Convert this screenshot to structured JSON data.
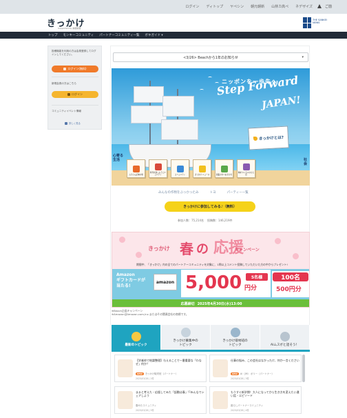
{
  "topbar": {
    "links": [
      "ログイン",
      "ディトップ",
      "ヤペシン",
      "朝元朝新",
      "山林カ高ペ",
      "ネデザイズ"
    ],
    "login": "ご前"
  },
  "header": {
    "logo": "きっかけ",
    "logo_sub": "Supported by 産経新聞",
    "news_name": "THE SANKEI NEWS"
  },
  "nav": {
    "items": [
      "トップ",
      "モンキーコミュニティ",
      "パートナーコミュニティ一覧",
      "ボキガイド ▾"
    ]
  },
  "sidebar": {
    "login_desc": "投稿機能を利用の方は会員登録してログインしてください。",
    "login_button": "ログイン(無料)",
    "register_desc": "新規会員の方はこちら",
    "register_button": "ログイン",
    "community_label": "コミュニティイベント情報",
    "small_link": "詳しく見る"
  },
  "main": {
    "dropdown_value": "<3/26> Beachから1年のお知らせ",
    "hero": {
      "jp_title": "ニッポンを一歩先へ",
      "en_title_1": "Step Forward",
      "en_title_2": "JAPAN!",
      "what_label": "きっかけとは?",
      "left_label": "心寄る生活",
      "right_label": "社会",
      "cards": [
        {
          "label": "ムラさん記事の場",
          "color": "#e86a2a"
        },
        {
          "label": "時代を楽しもうコミュニティ",
          "color": "#d84a3a"
        },
        {
          "label": "コミュニティ",
          "color": "#3a8ad8"
        },
        {
          "label": "きっかけ ニュース",
          "color": "#f2c01e"
        },
        {
          "label": "創業の方へおまかせ",
          "color": "#5aa84a"
        },
        {
          "label": "物をつくる人のひろば",
          "color": "#8a5ab0"
        }
      ]
    },
    "links": [
      "みんなの作物をぶっかったみ",
      "トヨ",
      "パーティー一覧"
    ],
    "cta_button": "きっかけに参加してみる♪（無料）",
    "metrics": [
      "参加人数：75,214名",
      "投稿数：146,219件"
    ],
    "spring": {
      "t1": "きっかけ",
      "t2": "春",
      "t3": "の",
      "t4": "応援",
      "t5": "キャンペーン",
      "desc": "期間中、「きっかけ」内の全てのパートナーコミュニティを対象に、1問以上コメント投稿していただいた方の中からプレゼント!",
      "amazon_text": "Amazon\nギフトカードが\n当たる!",
      "amazon_logo": "amazon",
      "big_amount": "5,000",
      "yen": "円分",
      "big_count": "5名様",
      "small_count": "100名",
      "small_amount": "500円分",
      "deadline_label": "応募締切",
      "deadline": "2025年4月30日(水)13:00"
    },
    "notes": [
      "※Beach企画キャンペーン",
      "※AmazonはAmazon.com,Inc.またはその関連会社の商標です。"
    ],
    "tabs": [
      {
        "label": "最新のトピック",
        "active": true,
        "icon_color": "#f5c842"
      },
      {
        "label": "きっかけ募集中の\nトピック",
        "active": false,
        "icon_color": "#c7d3dd"
      },
      {
        "label": "きっかけ取材班の\nトピック",
        "active": false,
        "icon_color": "#9ab6cc"
      },
      {
        "label": "AIムスボと話そう！",
        "active": false,
        "icon_color": "#b8c4cf"
      }
    ],
    "topics": [
      {
        "title": "【学者枠で結論整理】与えることで一番重要な「わなぜ」何か？",
        "new": "NEW",
        "author": "きっかけ取材班（パートナー）",
        "date": "2025/03/28 | 2件"
      },
      {
        "title": "仕事の悩み、この会社はなかったけ、何か一言ください",
        "new": "NEW",
        "author": "AI（JM） ボリー（パートナー）",
        "date": "2025/03/28 | 3件"
      },
      {
        "title": "まぁと考えた・応援してみた「起動は春」!?みんなでシェアしよう",
        "new": "",
        "author": "春みたコミュニティ",
        "date": "2025/03/28 | 5件"
      },
      {
        "title": "もうすぐ新学期！大人になってから生き方を変えたい違い話・エピソード",
        "new": "",
        "author": "暮らしパートナーコミュニティ",
        "date": "2025/03/28 | 4件"
      }
    ]
  }
}
